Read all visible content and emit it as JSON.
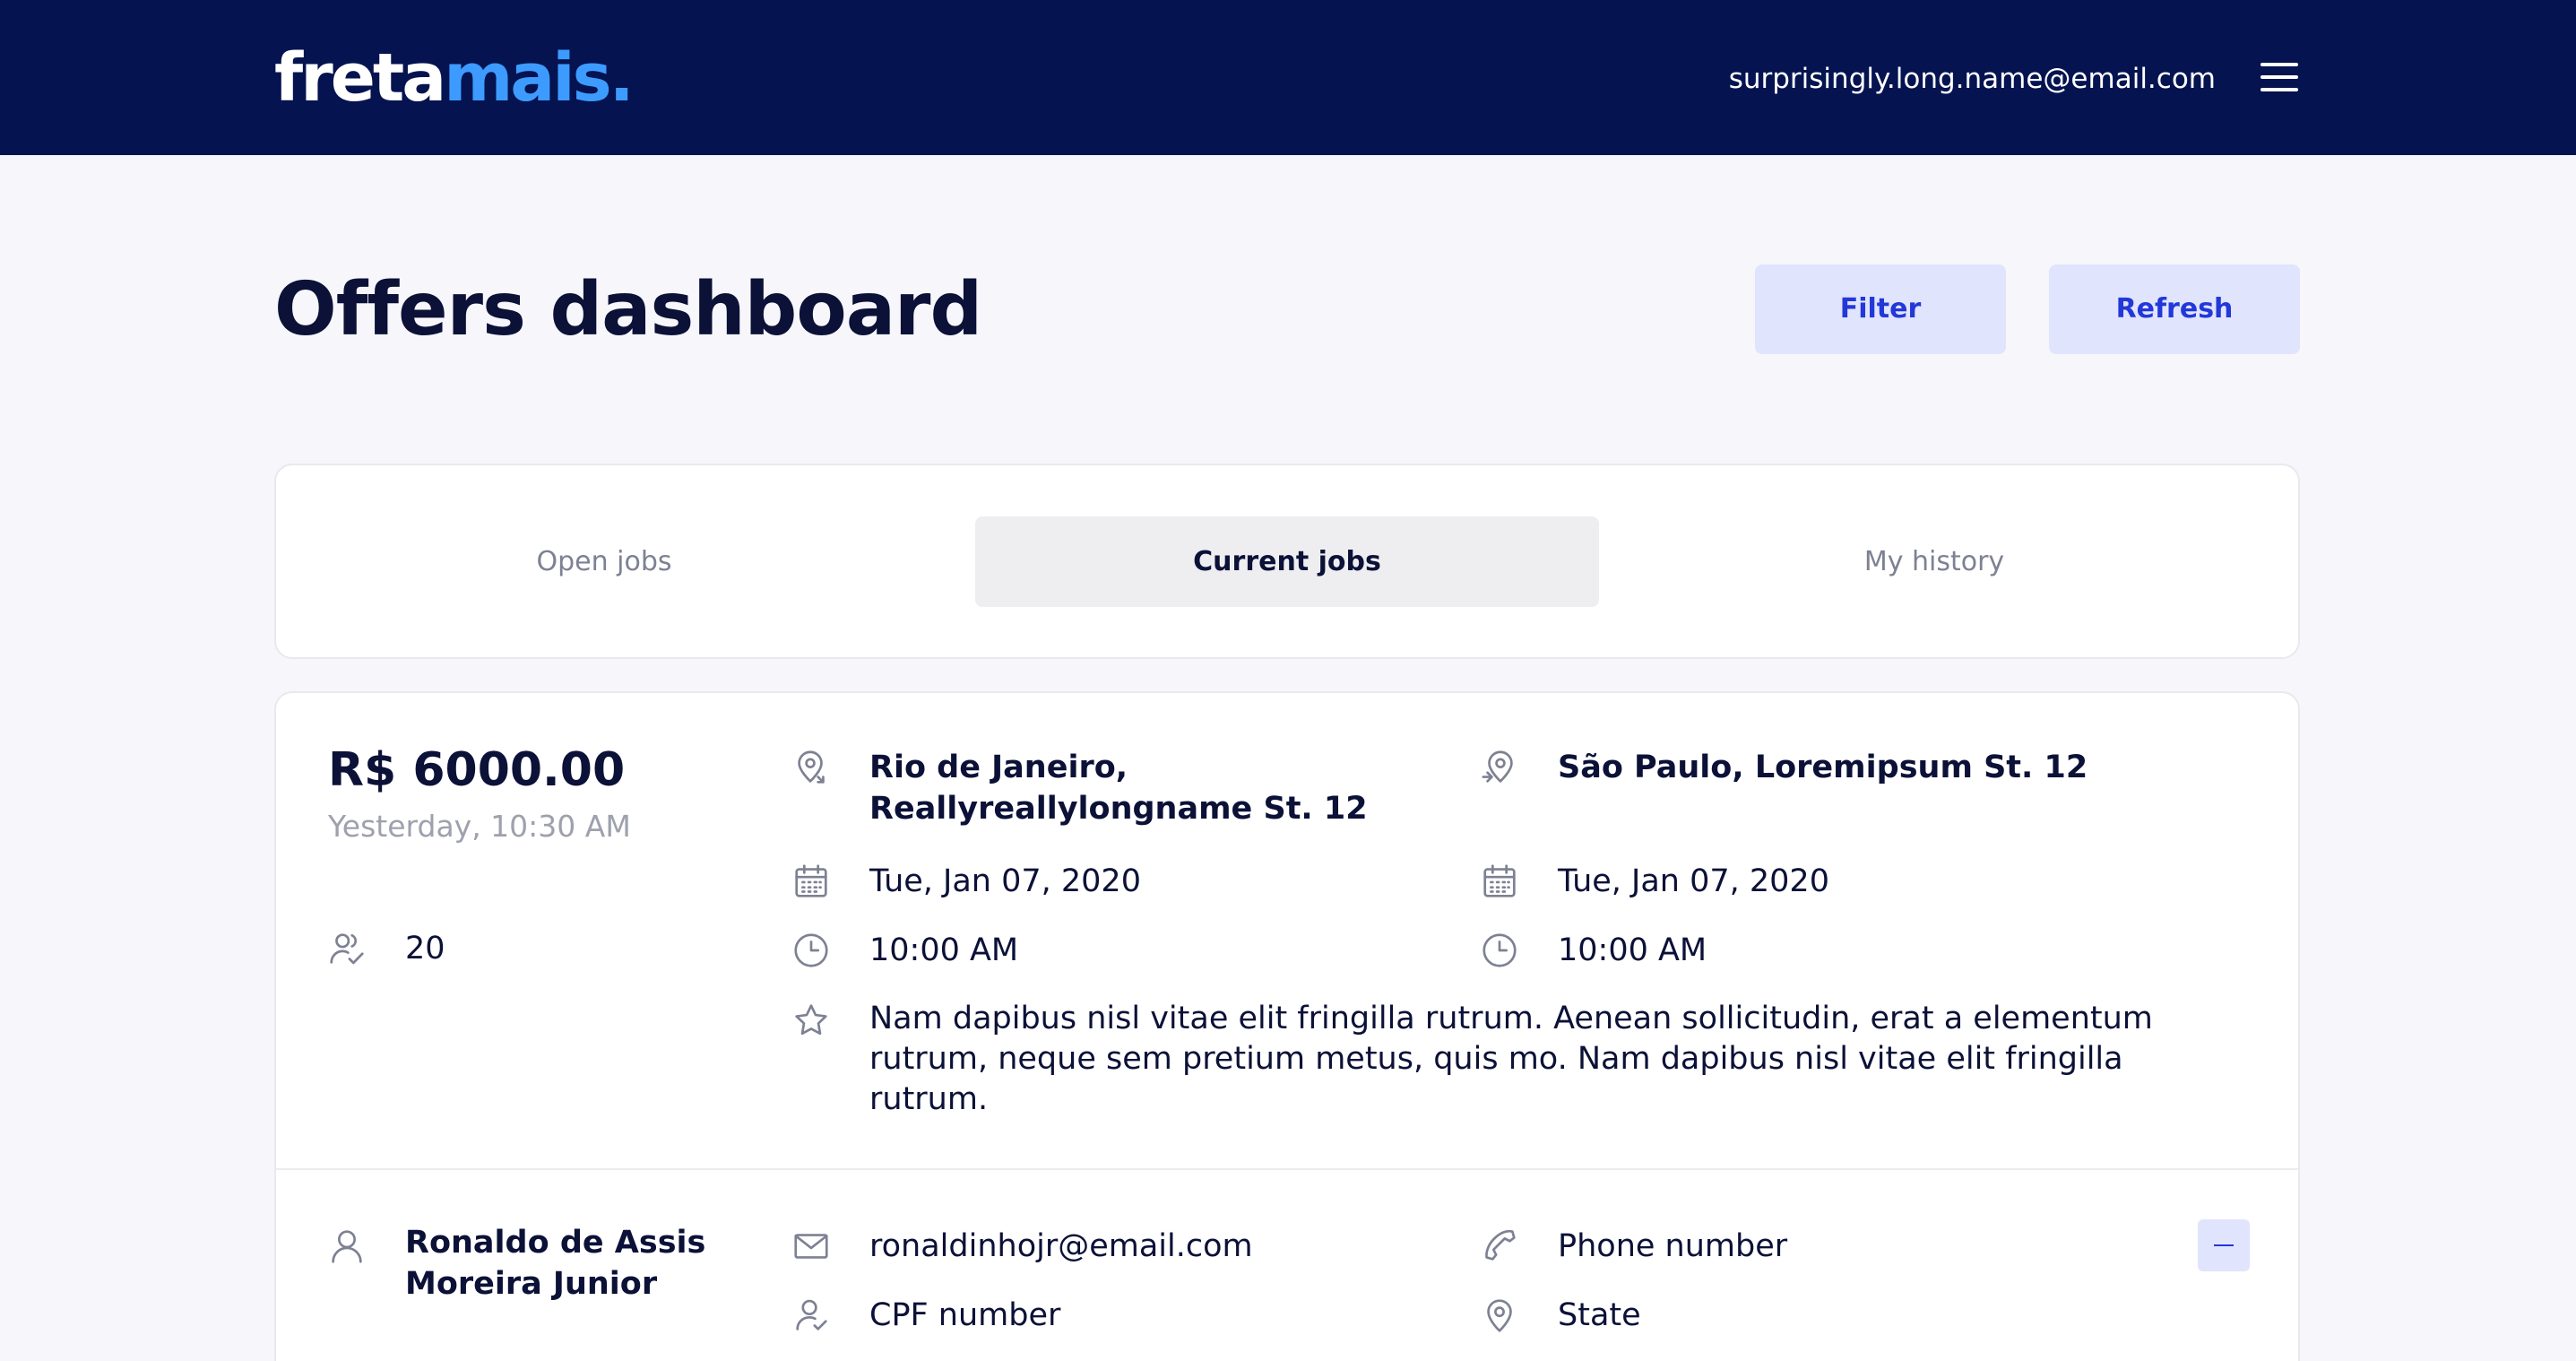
{
  "brand": {
    "part1": "freta",
    "part2": "mais",
    "dot": "."
  },
  "header": {
    "user_email": "surprisingly.long.name@email.com"
  },
  "page": {
    "title": "Offers dashboard",
    "filter_label": "Filter",
    "refresh_label": "Refresh"
  },
  "tabs": [
    {
      "label": "Open jobs",
      "active": false
    },
    {
      "label": "Current jobs",
      "active": true
    },
    {
      "label": "My history",
      "active": false
    }
  ],
  "job": {
    "price": "R$ 6000.00",
    "posted": "Yesterday, 10:30 AM",
    "passengers": "20",
    "origin_line1": "Rio de Janeiro,",
    "origin_line2": "Reallyreallylongname St. 12",
    "origin_date": "Tue, Jan 07, 2020",
    "origin_time": "10:00 AM",
    "destination": "São Paulo, Loremipsum St. 12",
    "destination_date": "Tue, Jan 07, 2020",
    "destination_time": "10:00 AM",
    "notes_line1": "Nam dapibus nisl vitae elit fringilla rutrum. Aenean sollicitudin, erat a elementum",
    "notes_line2": "rutrum, neque sem pretium metus, quis mo. Nam dapibus nisl vitae elit fringilla",
    "notes_line3": "rutrum."
  },
  "client": {
    "name_line1": "Ronaldo de Assis",
    "name_line2": "Moreira Junior",
    "email": "ronaldinhojr@email.com",
    "phone": "Phone number",
    "cpf": "CPF number",
    "state": "State"
  },
  "icons": {
    "origin": "pin-origin-icon",
    "destination": "pin-destination-icon",
    "date": "calendar-icon",
    "time": "clock-icon",
    "notes": "star-icon",
    "passengers": "users-check-icon",
    "person": "user-icon",
    "email": "mail-icon",
    "phone": "phone-icon",
    "cpf": "user-id-icon",
    "state": "location-pin-icon",
    "menu": "hamburger-menu-icon",
    "collapse": "minus-icon"
  },
  "colors": {
    "header_bg": "#051350",
    "brand_accent": "#3d9bff",
    "button_bg": "#e1e4fd",
    "button_text": "#2238d8",
    "text_primary": "#0b1137",
    "text_muted": "#9ea1ad"
  }
}
